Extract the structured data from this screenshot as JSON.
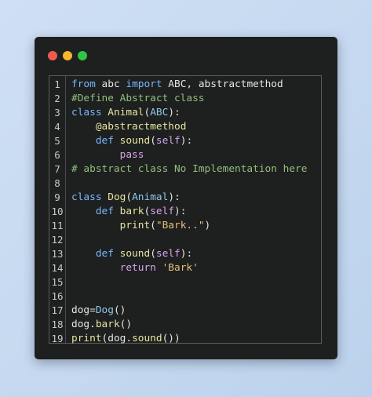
{
  "window": {
    "traffic_lights": [
      {
        "name": "close",
        "color": "#ef5a50"
      },
      {
        "name": "minimize",
        "color": "#f5b82e"
      },
      {
        "name": "maximize",
        "color": "#2fc443"
      }
    ]
  },
  "code_lines": [
    {
      "number": "1",
      "tokens": [
        [
          "kw",
          "from"
        ],
        [
          "pl",
          " abc "
        ],
        [
          "kw",
          "import"
        ],
        [
          "pl",
          " ABC, abstractmethod"
        ]
      ]
    },
    {
      "number": "2",
      "tokens": [
        [
          "cm",
          "#Define Abstract class"
        ]
      ]
    },
    {
      "number": "3",
      "tokens": [
        [
          "kw",
          "class"
        ],
        [
          "pl",
          " "
        ],
        [
          "fn",
          "Animal"
        ],
        [
          "pl",
          "("
        ],
        [
          "cl",
          "ABC"
        ],
        [
          "pl",
          "):"
        ]
      ]
    },
    {
      "number": "4",
      "tokens": [
        [
          "pl",
          "    "
        ],
        [
          "fn",
          "@abstractmethod"
        ]
      ]
    },
    {
      "number": "5",
      "tokens": [
        [
          "pl",
          "    "
        ],
        [
          "kw",
          "def"
        ],
        [
          "pl",
          " "
        ],
        [
          "fn",
          "sound"
        ],
        [
          "pl",
          "("
        ],
        [
          "bi",
          "self"
        ],
        [
          "pl",
          "):"
        ]
      ]
    },
    {
      "number": "6",
      "tokens": [
        [
          "pl",
          "        "
        ],
        [
          "bi",
          "pass"
        ]
      ]
    },
    {
      "number": "7",
      "tokens": [
        [
          "cm",
          "# abstract class No Implementation here"
        ]
      ]
    },
    {
      "number": "8",
      "tokens": []
    },
    {
      "number": "9",
      "tokens": [
        [
          "kw",
          "class"
        ],
        [
          "pl",
          " "
        ],
        [
          "fn",
          "Dog"
        ],
        [
          "pl",
          "("
        ],
        [
          "cl",
          "Animal"
        ],
        [
          "pl",
          "):"
        ]
      ]
    },
    {
      "number": "10",
      "tokens": [
        [
          "pl",
          "    "
        ],
        [
          "kw",
          "def"
        ],
        [
          "pl",
          " "
        ],
        [
          "fn",
          "bark"
        ],
        [
          "pl",
          "("
        ],
        [
          "bi",
          "self"
        ],
        [
          "pl",
          "):"
        ]
      ]
    },
    {
      "number": "11",
      "tokens": [
        [
          "pl",
          "        "
        ],
        [
          "fn",
          "print"
        ],
        [
          "pl",
          "("
        ],
        [
          "st",
          "\"Bark..\""
        ],
        [
          "pl",
          ")"
        ]
      ]
    },
    {
      "number": "12",
      "tokens": []
    },
    {
      "number": "13",
      "tokens": [
        [
          "pl",
          "    "
        ],
        [
          "kw",
          "def"
        ],
        [
          "pl",
          " "
        ],
        [
          "fn",
          "sound"
        ],
        [
          "pl",
          "("
        ],
        [
          "bi",
          "self"
        ],
        [
          "pl",
          "):"
        ]
      ]
    },
    {
      "number": "14",
      "tokens": [
        [
          "pl",
          "        "
        ],
        [
          "bi",
          "return"
        ],
        [
          "pl",
          " "
        ],
        [
          "st",
          "'Bark'"
        ]
      ]
    },
    {
      "number": "15",
      "tokens": []
    },
    {
      "number": "16",
      "tokens": []
    },
    {
      "number": "17",
      "tokens": [
        [
          "pl",
          "dog="
        ],
        [
          "cl",
          "Dog"
        ],
        [
          "pl",
          "()"
        ]
      ]
    },
    {
      "number": "18",
      "tokens": [
        [
          "pl",
          "dog."
        ],
        [
          "fn",
          "bark"
        ],
        [
          "pl",
          "()"
        ]
      ]
    },
    {
      "number": "19",
      "tokens": [
        [
          "fn",
          "print"
        ],
        [
          "pl",
          "(dog."
        ],
        [
          "fn",
          "sound"
        ],
        [
          "pl",
          "())"
        ]
      ]
    }
  ]
}
